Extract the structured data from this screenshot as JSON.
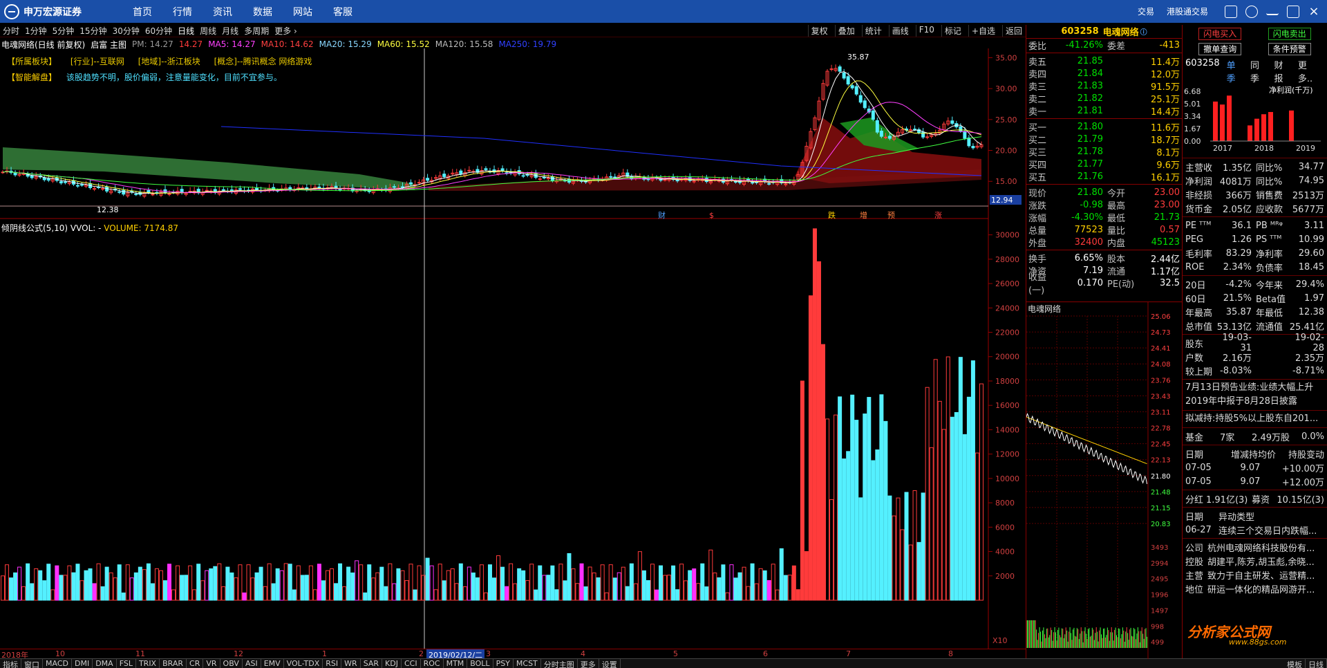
{
  "app": {
    "logo_text": "申万宏源证券",
    "nav": [
      "首页",
      "行情",
      "资讯",
      "数据",
      "网站",
      "客服"
    ],
    "right_links": [
      "交易",
      "港股通交易"
    ]
  },
  "periods": [
    "分时",
    "1分钟",
    "5分钟",
    "15分钟",
    "30分钟",
    "60分钟",
    "日线",
    "周线",
    "月线",
    "多周期",
    "更多 ›"
  ],
  "tools": [
    "复权",
    "叠加",
    "统计",
    "画线",
    "F10",
    "标记",
    "+自选",
    "返回"
  ],
  "info": {
    "title": "电魂网络(日线 前复权)",
    "strategy": "启富 主图",
    "pm_label": "PM: 14.27",
    "pm_value": "14.27",
    "ma5": "MA5: 14.27",
    "ma10": "MA10: 14.62",
    "ma20": "MA20: 15.29",
    "ma60": "MA60: 15.52",
    "ma120": "MA120: 15.58",
    "ma250": "MA250: 19.79"
  },
  "tags": [
    "【所属板块】",
    "[行业]--互联网",
    "[地域]--浙江板块",
    "[概念]--腾讯概念 网络游戏"
  ],
  "advice_label": "【智能解盘】",
  "advice_text": "该股趋势不明，股价偏弱，注意量能变化，目前不宜参与。",
  "price_axis": [
    "35.00",
    "30.00",
    "25.00",
    "20.00",
    "15.00"
  ],
  "price_marks": {
    "high": "35.87",
    "low": "12.38",
    "cursor_price": "12.94"
  },
  "event_marks": [
    "财",
    "$",
    "跌",
    "增",
    "预",
    "涨"
  ],
  "vol_info": {
    "formula": "倾阴线公式(5,10)",
    "vvol": "VVOL: -",
    "volume": "VOLUME: 7174.87"
  },
  "vol_axis": [
    "30000",
    "28000",
    "26000",
    "24000",
    "22000",
    "20000",
    "18000",
    "16000",
    "14000",
    "12000",
    "10000",
    "8000",
    "6000",
    "4000",
    "2000"
  ],
  "vol_scale": "X10",
  "x_months": [
    "2018年",
    "10",
    "11",
    "12",
    "1",
    "2",
    "3",
    "4",
    "5",
    "6",
    "7",
    "8"
  ],
  "cursor_date": "2019/02/12/二",
  "bottom_tabs": [
    "指标",
    "窗口",
    "MACD",
    "DMI",
    "DMA",
    "FSL",
    "TRIX",
    "BRAR",
    "CR",
    "VR",
    "OBV",
    "ASI",
    "EMV",
    "VOL-TDX",
    "RSI",
    "WR",
    "SAR",
    "KDJ",
    "CCI",
    "ROC",
    "MTM",
    "BOLL",
    "PSY",
    "MCST",
    "分时主图",
    "更多",
    "设置"
  ],
  "bottom_right": [
    "模板",
    "日线"
  ],
  "quote": {
    "code": "603258",
    "name": "电魂网络",
    "weibi_label": "委比",
    "weibi": "-41.26%",
    "weicha_label": "委差",
    "weicha": "-413",
    "asks": [
      {
        "label": "卖五",
        "price": "21.85",
        "vol": "11.4万"
      },
      {
        "label": "卖四",
        "price": "21.84",
        "vol": "12.0万"
      },
      {
        "label": "卖三",
        "price": "21.83",
        "vol": "91.5万"
      },
      {
        "label": "卖二",
        "price": "21.82",
        "vol": "25.1万"
      },
      {
        "label": "卖一",
        "price": "21.81",
        "vol": "14.4万"
      }
    ],
    "bids": [
      {
        "label": "买一",
        "price": "21.80",
        "vol": "11.6万"
      },
      {
        "label": "买二",
        "price": "21.79",
        "vol": "18.7万"
      },
      {
        "label": "买三",
        "price": "21.78",
        "vol": "8.1万"
      },
      {
        "label": "买四",
        "price": "21.77",
        "vol": "9.6万"
      },
      {
        "label": "买五",
        "price": "21.76",
        "vol": "16.1万"
      }
    ],
    "stats": [
      {
        "a": "现价",
        "b": "21.80",
        "c": "今开",
        "d": "23.00"
      },
      {
        "a": "涨跌",
        "b": "-0.98",
        "c": "最高",
        "d": "23.00"
      },
      {
        "a": "涨幅",
        "b": "-4.30%",
        "c": "最低",
        "d": "21.73"
      },
      {
        "a": "总量",
        "b": "77523",
        "c": "量比",
        "d": "0.57"
      },
      {
        "a": "外盘",
        "b": "32400",
        "c": "内盘",
        "d": "45123"
      }
    ],
    "stats2": [
      {
        "a": "换手",
        "b": "6.65%",
        "c": "股本",
        "d": "2.44亿"
      },
      {
        "a": "净资",
        "b": "7.19",
        "c": "流通",
        "d": "1.17亿"
      },
      {
        "a": "收益(一)",
        "b": "0.170",
        "c": "PE(动)",
        "d": "32.5"
      }
    ]
  },
  "intraday": {
    "label": "电魂网络",
    "price_axis": [
      "25.06",
      "24.73",
      "24.41",
      "24.08",
      "23.76",
      "23.43",
      "23.11",
      "22.78",
      "22.45",
      "22.13",
      "21.80",
      "21.48",
      "21.15",
      "20.83"
    ],
    "vol_axis": [
      "3493",
      "2994",
      "2495",
      "1996",
      "1497",
      "998",
      "499"
    ]
  },
  "f10": {
    "buttons": [
      "闪电买入",
      "闪电卖出",
      "撤单查询",
      "条件预警"
    ],
    "code": "603258",
    "tabs": [
      "单季",
      "同季",
      "财报",
      "更多.."
    ],
    "profit_label": "净利润(千万)",
    "profit_axis": [
      "6.68",
      "5.01",
      "3.34",
      "1.67",
      "0.00"
    ],
    "profit_years": [
      "2017",
      "2018",
      "2019"
    ],
    "profit_values": [
      5.3,
      4.9,
      6.1,
      2.1,
      3.0,
      3.6,
      3.9,
      4.1
    ],
    "rows1": [
      {
        "a": "主营收",
        "b": "1.35亿",
        "c": "同比%",
        "d": "34.77"
      },
      {
        "a": "净利润",
        "b": "4081万",
        "c": "同比%",
        "d": "74.95"
      },
      {
        "a": "非经损",
        "b": "366万",
        "c": "销售费",
        "d": "2513万"
      },
      {
        "a": "货币金",
        "b": "2.05亿",
        "c": "应收款",
        "d": "5677万"
      }
    ],
    "rows2": [
      {
        "a": "PE ᵀᵀᴹ",
        "b": "36.1",
        "c": "PB ᴹᴿᵠ",
        "d": "3.11"
      },
      {
        "a": "PEG",
        "b": "1.26",
        "c": "PS ᵀᵀᴹ",
        "d": "10.99"
      },
      {
        "a": "毛利率",
        "b": "83.29",
        "c": "净利率",
        "d": "29.60"
      },
      {
        "a": "ROE",
        "b": "2.34%",
        "c": "负债率",
        "d": "18.45"
      }
    ],
    "rows3": [
      {
        "a": "20日",
        "b": "-4.2%",
        "c": "今年来",
        "d": "29.4%"
      },
      {
        "a": "60日",
        "b": "21.5%",
        "c": "Beta值",
        "d": "1.97"
      },
      {
        "a": "年最高",
        "b": "35.87",
        "c": "年最低",
        "d": "12.38"
      },
      {
        "a": "总市值",
        "b": "53.13亿",
        "c": "流通值",
        "d": "25.41亿"
      }
    ],
    "holders": [
      {
        "a": "股东",
        "b": "19-03-31",
        "d": "19-02-28"
      },
      {
        "a": "户数",
        "b": "2.16万",
        "d": "2.35万"
      },
      {
        "a": "较上期",
        "b": "-8.03%",
        "d": "-8.71%"
      }
    ],
    "notes": [
      "7月13日预告业绩:业绩大幅上升",
      "2019年中报于8月28日披露",
      "拟减持:持股5%以上股东自201..."
    ],
    "fund": {
      "a": "基金",
      "b": "7家",
      "c": "2.49万股",
      "d": "0.0%"
    },
    "trade_head": {
      "a": "日期",
      "b": "增减持均价",
      "c": "持股变动"
    },
    "trades": [
      {
        "a": "07-05",
        "b": "9.07",
        "c": "+10.00万"
      },
      {
        "a": "07-05",
        "b": "9.07",
        "c": "+12.00万"
      }
    ],
    "dividend": {
      "a": "分红",
      "b": "1.91亿(3)",
      "c": "募资",
      "d": "10.15亿(3)"
    },
    "event_head": {
      "a": "日期",
      "b": "异动类型"
    },
    "event": {
      "a": "06-27",
      "b": "连续三个交易日内跌幅..."
    },
    "company": [
      {
        "a": "公司",
        "b": "杭州电魂网络科技股份有..."
      },
      {
        "a": "控股",
        "b": "胡建平,陈芳,胡玉彪,余晓..."
      },
      {
        "a": "主营",
        "b": "致力于自主研发、运营精..."
      },
      {
        "a": "地位",
        "b": "研运一体化的精品网游开..."
      }
    ]
  },
  "watermark": {
    "main": "分析家公式网",
    "sub": "www.88gs.com"
  },
  "colors": {
    "up": "#ff3b3b",
    "down": "#54f0ff",
    "accent": "#ffd000",
    "nav_bg": "#1a4fa8"
  }
}
